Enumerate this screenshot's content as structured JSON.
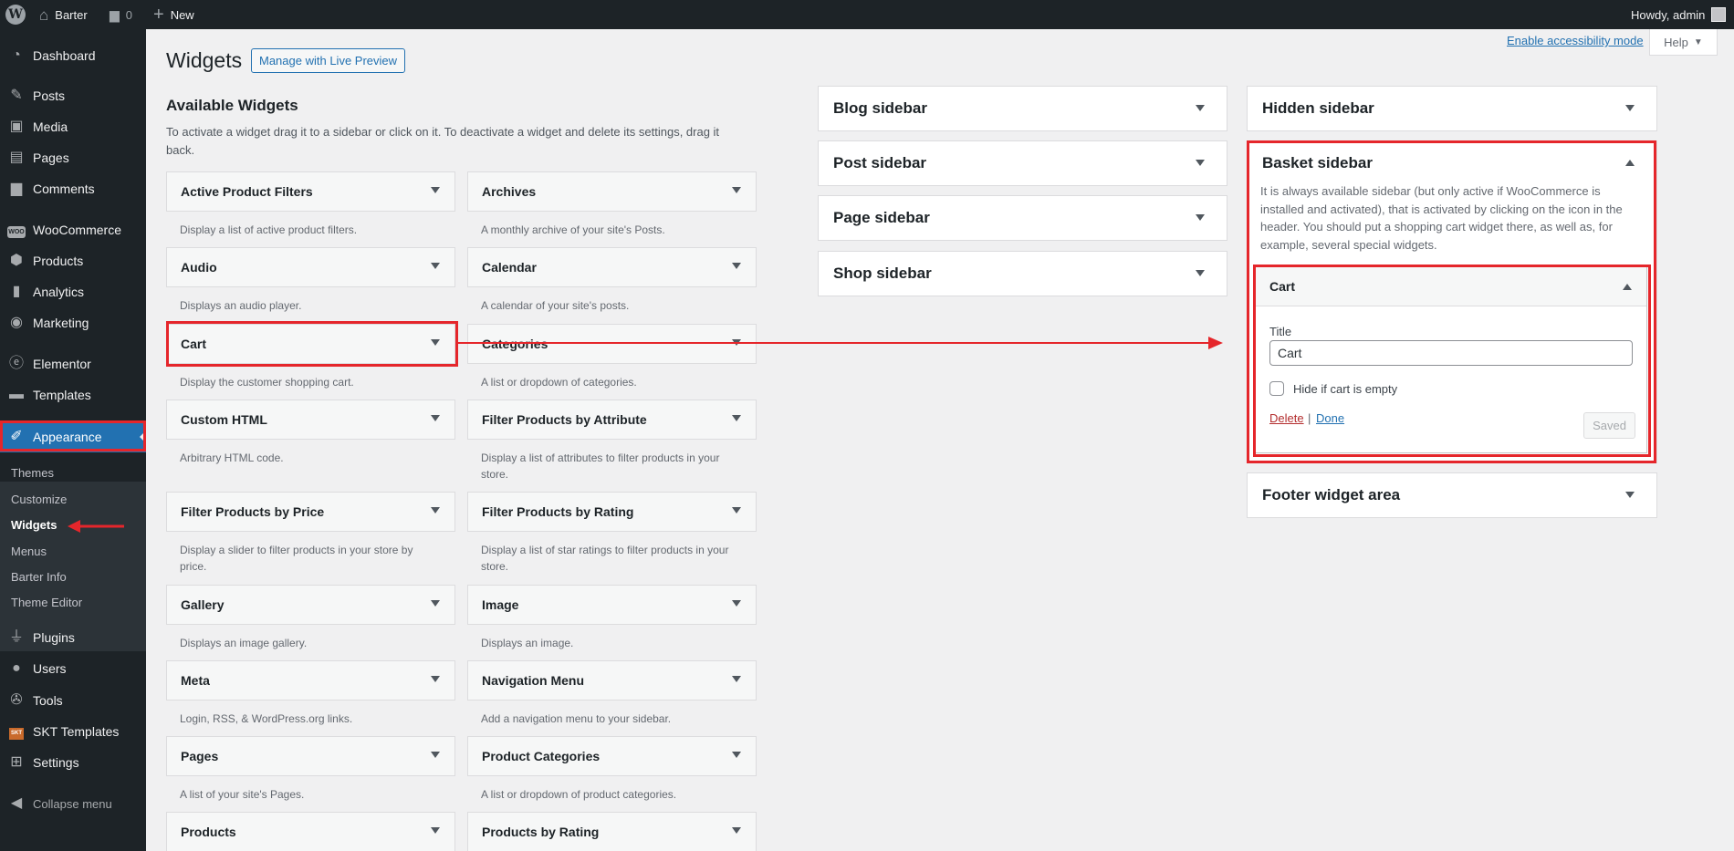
{
  "admin_bar": {
    "site_name": "Barter",
    "comments_count": "0",
    "new_label": "New",
    "greeting": "Howdy, admin",
    "icons": [
      "wordpress-logo-icon",
      "home-icon",
      "comment-icon",
      "plus-icon",
      "avatar"
    ]
  },
  "menu": {
    "items": [
      {
        "label": "Dashboard",
        "icon": "dashboard-icon"
      },
      {
        "label": "Posts",
        "icon": "pin-icon"
      },
      {
        "label": "Media",
        "icon": "media-icon"
      },
      {
        "label": "Pages",
        "icon": "pages-icon"
      },
      {
        "label": "Comments",
        "icon": "comment-icon"
      },
      {
        "label": "WooCommerce",
        "icon": "woocommerce-icon"
      },
      {
        "label": "Products",
        "icon": "products-icon"
      },
      {
        "label": "Analytics",
        "icon": "analytics-icon"
      },
      {
        "label": "Marketing",
        "icon": "megaphone-icon"
      },
      {
        "label": "Elementor",
        "icon": "elementor-icon"
      },
      {
        "label": "Templates",
        "icon": "folder-icon"
      },
      {
        "label": "Appearance",
        "icon": "paintbrush-icon"
      },
      {
        "label": "Plugins",
        "icon": "plug-icon"
      },
      {
        "label": "Users",
        "icon": "user-icon"
      },
      {
        "label": "Tools",
        "icon": "wrench-icon"
      },
      {
        "label": "SKT Templates",
        "icon": "skt-icon"
      },
      {
        "label": "Settings",
        "icon": "settings-icon"
      },
      {
        "label": "Collapse menu",
        "icon": "collapse-icon"
      }
    ],
    "woo_badge": "WOO",
    "skt_badge": "SKT",
    "submenu": [
      "Themes",
      "Customize",
      "Widgets",
      "Menus",
      "Barter Info",
      "Theme Editor"
    ]
  },
  "header": {
    "title": "Widgets",
    "live_preview_button": "Manage with Live Preview",
    "accessibility_link": "Enable accessibility mode",
    "help_label": "Help"
  },
  "available_widgets": {
    "title": "Available Widgets",
    "description": "To activate a widget drag it to a sidebar or click on it. To deactivate a widget and delete its settings, drag it back.",
    "widgets": [
      {
        "name": "Active Product Filters",
        "description": "Display a list of active product filters."
      },
      {
        "name": "Archives",
        "description": "A monthly archive of your site's Posts."
      },
      {
        "name": "Audio",
        "description": "Displays an audio player."
      },
      {
        "name": "Calendar",
        "description": "A calendar of your site's posts."
      },
      {
        "name": "Cart",
        "description": "Display the customer shopping cart."
      },
      {
        "name": "Categories",
        "description": "A list or dropdown of categories."
      },
      {
        "name": "Custom HTML",
        "description": "Arbitrary HTML code."
      },
      {
        "name": "Filter Products by Attribute",
        "description": "Display a list of attributes to filter products in your store."
      },
      {
        "name": "Filter Products by Price",
        "description": "Display a slider to filter products in your store by price."
      },
      {
        "name": "Filter Products by Rating",
        "description": "Display a list of star ratings to filter products in your store."
      },
      {
        "name": "Gallery",
        "description": "Displays an image gallery."
      },
      {
        "name": "Image",
        "description": "Displays an image."
      },
      {
        "name": "Meta",
        "description": "Login, RSS, & WordPress.org links."
      },
      {
        "name": "Navigation Menu",
        "description": "Add a navigation menu to your sidebar."
      },
      {
        "name": "Pages",
        "description": "A list of your site's Pages."
      },
      {
        "name": "Product Categories",
        "description": "A list or dropdown of product categories."
      },
      {
        "name": "Products",
        "description": ""
      },
      {
        "name": "Products by Rating",
        "description": ""
      }
    ]
  },
  "sidebars": {
    "blog": "Blog sidebar",
    "post": "Post sidebar",
    "page": "Page sidebar",
    "shop": "Shop sidebar",
    "hidden": "Hidden sidebar",
    "basket": {
      "title": "Basket sidebar",
      "description": "It is always available sidebar (but only active if WooCommerce is installed and activated), that is activated by clicking on the icon in the header. You should put a shopping cart widget there, as well as, for example, several special widgets."
    },
    "footer": "Footer widget area"
  },
  "cart_widget": {
    "title": "Cart",
    "field_label": "Title",
    "field_value": "Cart",
    "checkbox_label": "Hide if cart is empty",
    "checkbox_checked": false,
    "delete_label": "Delete",
    "separator": "|",
    "done_label": "Done",
    "saved_label": "Saved"
  },
  "colors": {
    "admin_bar": "#1d2327",
    "accent": "#2271b1",
    "annotation_red": "#e5262b",
    "background": "#f0f0f1"
  }
}
